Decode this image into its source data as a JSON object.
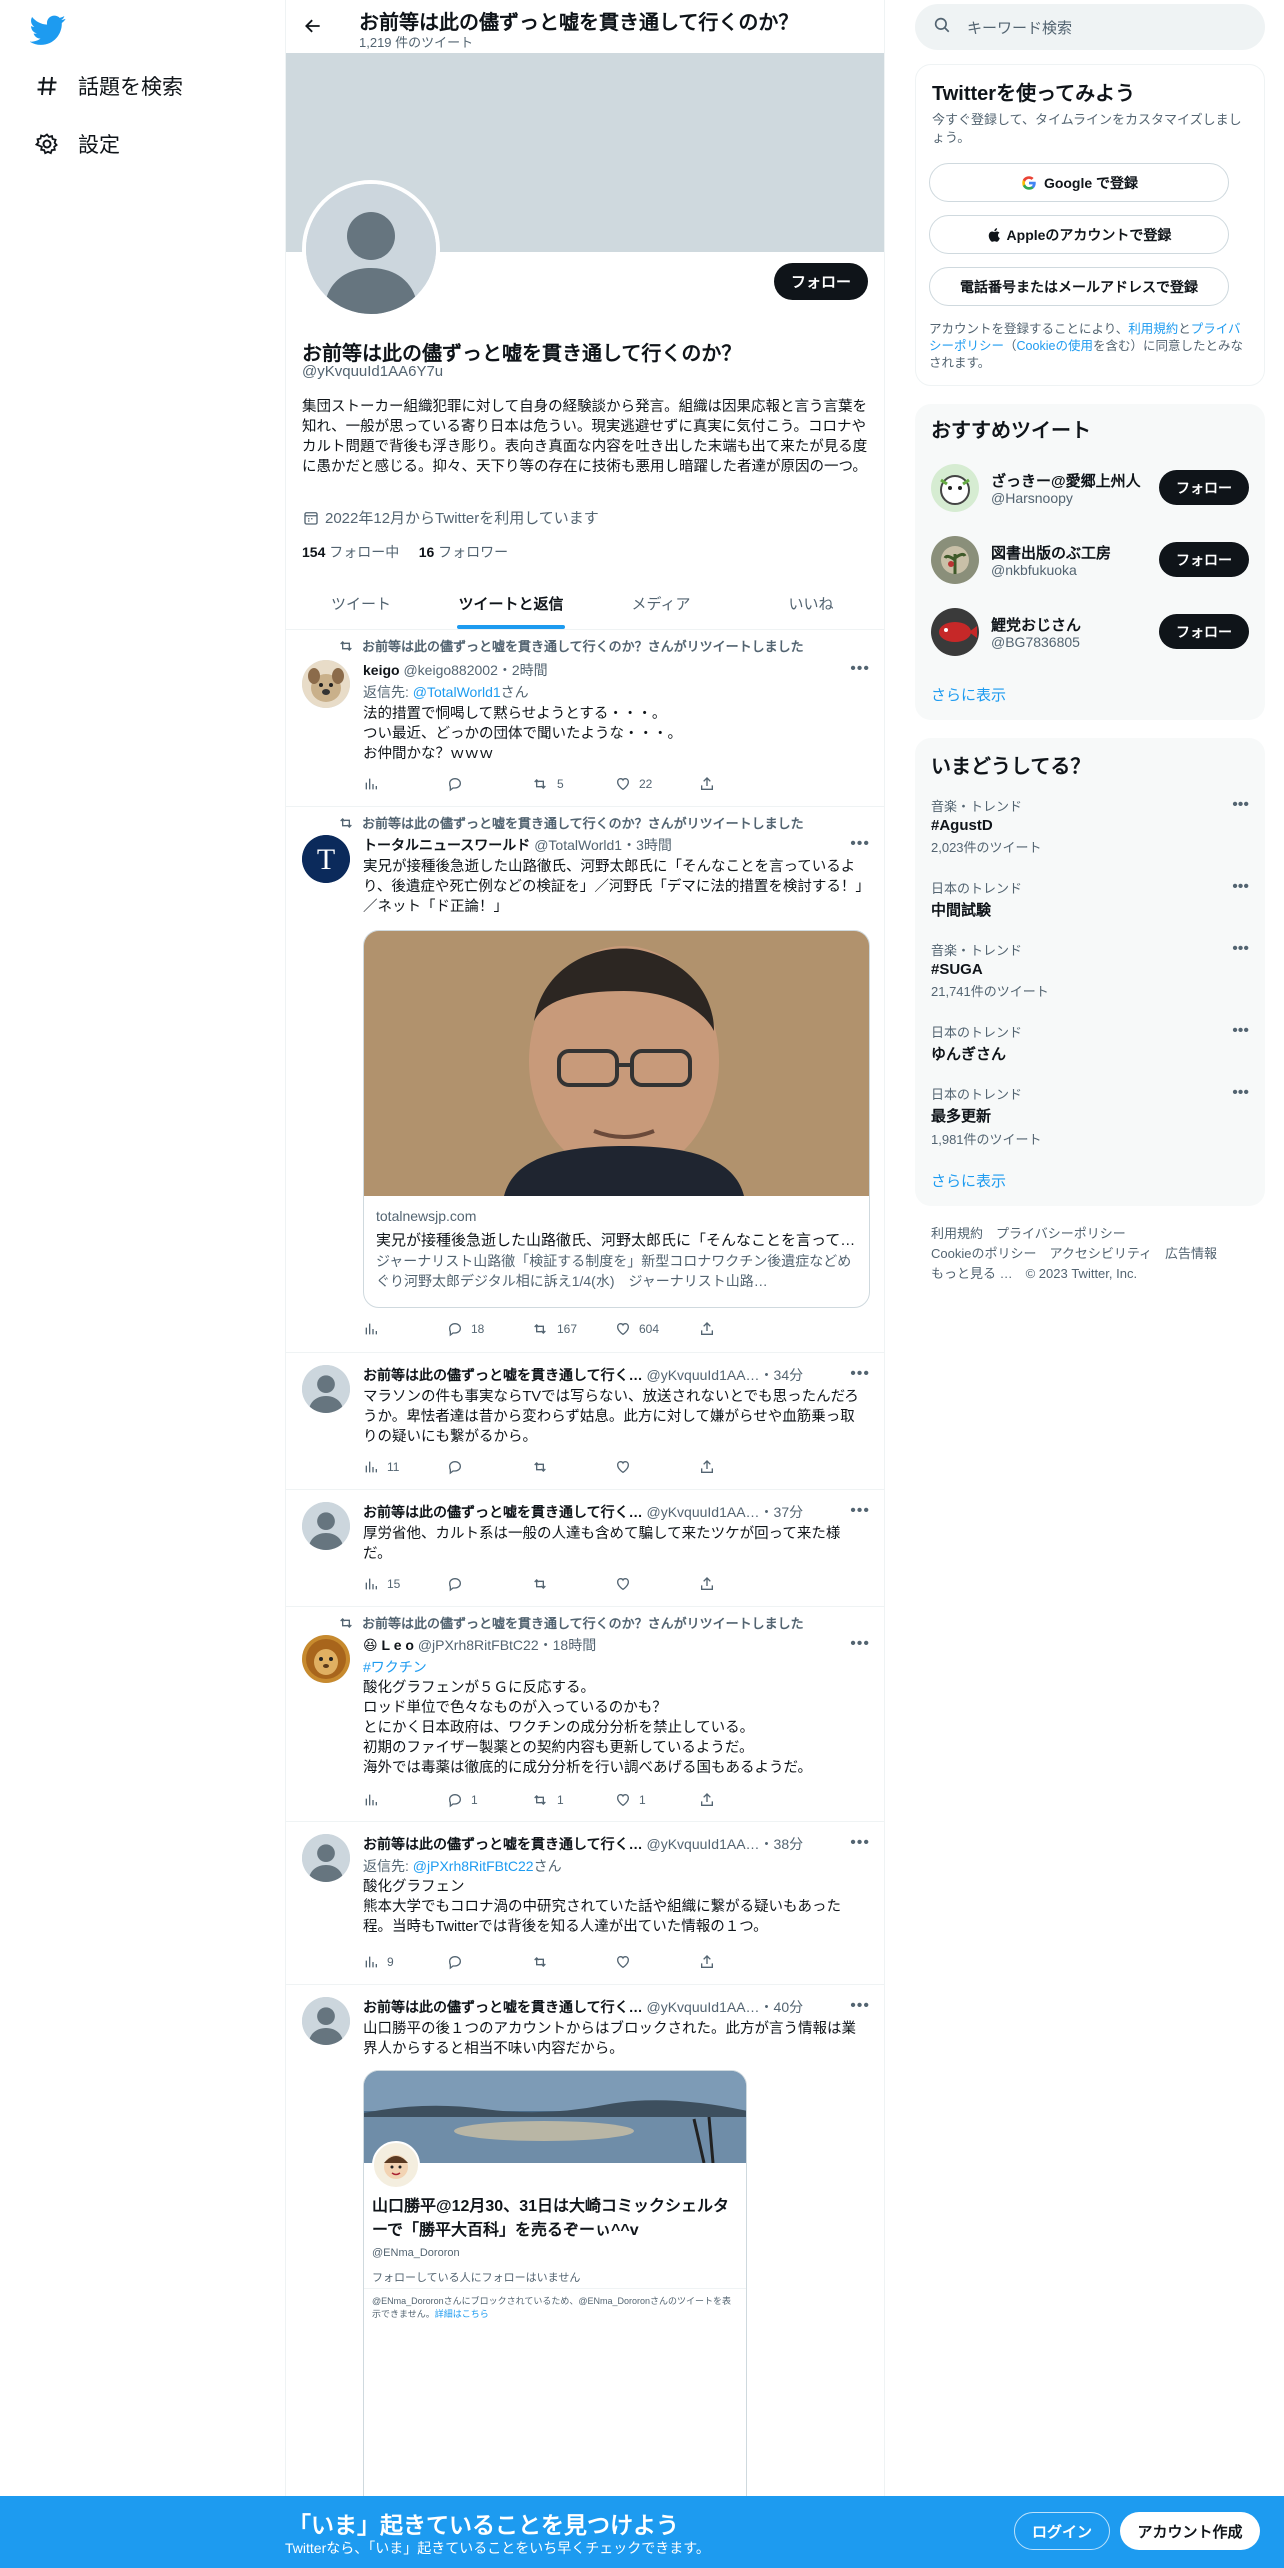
{
  "nav": {
    "explore_label": "話題を検索",
    "settings_label": "設定"
  },
  "header": {
    "title": "お前等は此の儘ずっと嘘を貫き通して行くのか？",
    "tweet_count": "1,219 件のツイート"
  },
  "profile": {
    "name": "お前等は此の儘ずっと嘘を貫き通して行くのか？",
    "handle": "@yKvquuId1AA6Y7u",
    "bio": "集団ストーカー組織犯罪に対して自身の経験談から発言。組織は因果応報と言う言葉を知れ、一般が思っている寄り日本は危うい。現実逃避せずに真実に気付こう。コロナやカルト問題で背後も浮き彫り。表向き真面な内容を吐き出した末端も出て来たが見る度に愚かだと感じる。抑々、天下り等の存在に技術も悪用し暗躍した者達が原因の一つ。",
    "joined": "2022年12月からTwitterを利用しています",
    "following_count": "154",
    "following_label": "フォロー中",
    "followers_count": "16",
    "followers_label": "フォロワー",
    "follow_button": "フォロー"
  },
  "tabs": [
    "ツイート",
    "ツイートと返信",
    "メディア",
    "いいね"
  ],
  "tweets": [
    {
      "retweet_note": "お前等は此の儘ずっと嘘を貫き通して行くのか？さんがリツイートしました",
      "name": "keigo",
      "handle": "@keigo882002",
      "time": "・2時間",
      "reply_prefix": "返信先: ",
      "reply_to": "@TotalWorld1",
      "reply_suffix": "さん",
      "text": "法的措置で恫喝して黙らせようとする・・・。\nつい最近、どっかの団体で聞いたような・・・。\nお仲間かな？ｗｗｗ",
      "views": "",
      "replies": "",
      "retweets": "5",
      "likes": "22"
    },
    {
      "retweet_note": "お前等は此の儘ずっと嘘を貫き通して行くのか？さんがリツイートしました",
      "name": "トータルニュースワールド",
      "handle": "@TotalWorld1",
      "time": "・3時間",
      "text": "実兄が接種後急逝した山路徹氏、河野太郎氏に「そんなことを言っているより、後遺症や死亡例などの検証を」／河野氏「デマに法的措置を検討する！」／ネット「ド正論！」",
      "card_domain": "totalnewsjp.com",
      "card_title": "実兄が接種後急逝した山路徹氏、河野太郎氏に「そんなことを言って…",
      "card_desc": "ジャーナリスト山路徹「検証する制度を」新型コロナワクチン後遺症などめぐり河野太郎デジタル相に訴え1/4(水)　ジャーナリスト山路…",
      "views": "",
      "replies": "18",
      "retweets": "167",
      "likes": "604"
    },
    {
      "name": "お前等は此の儘ずっと嘘を貫き通して行く…",
      "handle": "@yKvquuId1AA…",
      "time": "・34分",
      "text": "マラソンの件も事実ならTVでは写らない、放送されないとでも思ったんだろうか。卑怯者達は昔から変わらず姑息。此方に対して嫌がらせや血筋乗っ取りの疑いにも繋がるから。",
      "views": "11",
      "replies": "",
      "retweets": "",
      "likes": ""
    },
    {
      "name": "お前等は此の儘ずっと嘘を貫き通して行く…",
      "handle": "@yKvquuId1AA…",
      "time": "・37分",
      "text": "厚労省他、カルト系は一般の人達も含めて騙して来たツケが回って来た様だ。",
      "views": "15",
      "replies": "",
      "retweets": "",
      "likes": ""
    },
    {
      "retweet_note": "お前等は此の儘ずっと嘘を貫き通して行くのか？さんがリツイートしました",
      "name": "L e o",
      "handle": "@jPXrh8RitFBtC22",
      "time": "・18時間",
      "hashtag": "#ワクチン",
      "text": "酸化グラフェンが５Ｇに反応する。\nロッド単位で色々なものが入っているのかも？\nとにかく日本政府は、ワクチンの成分分析を禁止している。\n初期のファイザー製薬との契約内容も更新しているようだ。\n海外では毒薬は徹底的に成分分析を行い調べあげる国もあるようだ。",
      "views": "",
      "replies": "1",
      "retweets": "1",
      "likes": "1"
    },
    {
      "name": "お前等は此の儘ずっと嘘を貫き通して行く…",
      "handle": "@yKvquuId1AA…",
      "time": "・38分",
      "reply_prefix": "返信先: ",
      "reply_to": "@jPXrh8RitFBtC22",
      "reply_suffix": "さん",
      "text": "酸化グラフェン\n熊本大学でもコロナ渦の中研究されていた話や組織に繋がる疑いもあった程。当時もTwitterでは背後を知る人達が出ていた情報の１つ。",
      "views": "9",
      "replies": "",
      "retweets": "",
      "likes": ""
    },
    {
      "name": "お前等は此の儘ずっと嘘を貫き通して行く…",
      "handle": "@yKvquuId1AA…",
      "time": "・40分",
      "text": "山口勝平の後１つのアカウントからはブロックされた。此方が言う情報は業界人からすると相当不味い内容だから。",
      "embed_name": "山口勝平@12月30、31日は大崎コミックシェルターで「勝平大百科」を売るぞーぃ^^v",
      "embed_handle": "@ENma_Dororon",
      "embed_note": "フォローしている人にフォローはいません",
      "embed_blocked": "@ENma_Dororonさんにブロックされているため、@ENma_Dororonさんのツイートを表示できません。",
      "embed_link": "詳細はこちら"
    }
  ],
  "right": {
    "search_placeholder": "キーワード検索",
    "signup_title": "Twitterを使ってみよう",
    "signup_sub": "今すぐ登録して、タイムラインをカスタマイズしましょう。",
    "google_btn": "Google で登録",
    "apple_btn": "Appleのアカウントで登録",
    "phone_btn": "電話番号またはメールアドレスで登録",
    "terms_pre": "アカウントを登録することにより、",
    "terms_link": "利用規約",
    "terms_mid": "と",
    "privacy_link": "プライバシーポリシー",
    "cookie_pre": "（",
    "cookie_link": "Cookieの使用",
    "terms_post": "を含む）に同意したとみなされます。",
    "rec_title": "おすすめツイート",
    "recs": [
      {
        "name": "ざっきー@愛郷上州人",
        "handle": "@Harsnoopy",
        "button": "フォロー"
      },
      {
        "name": "図書出版のぶ工房",
        "handle": "@nkbfukuoka",
        "button": "フォロー"
      },
      {
        "name": "鯉党おじさん",
        "handle": "@BG7836805",
        "button": "フォロー"
      }
    ],
    "show_more": "さらに表示",
    "trends_title": "いまどうしてる？",
    "trends": [
      {
        "context": "音楽・トレンド",
        "name": "#AgustD",
        "count": "2,023件のツイート"
      },
      {
        "context": "日本のトレンド",
        "name": "中間試験",
        "count": ""
      },
      {
        "context": "音楽・トレンド",
        "name": "#SUGA",
        "count": "21,741件のツイート"
      },
      {
        "context": "日本のトレンド",
        "name": "ゆんぎさん",
        "count": ""
      },
      {
        "context": "日本のトレンド",
        "name": "最多更新",
        "count": "1,981件のツイート"
      }
    ],
    "footer_line1": "利用規約　プライバシーポリシー",
    "footer_line2": "Cookieのポリシー　アクセシビリティ　広告情報",
    "footer_line3": "もっと見る …　© 2023 Twitter, Inc."
  },
  "bottom": {
    "title": "「いま」起きていることを見つけよう",
    "subtitle": "Twitterなら、「いま」起きていることをいち早くチェックできます。",
    "login": "ログイン",
    "signup": "アカウント作成"
  },
  "colors": {
    "accent": "#1d9bf0",
    "text": "#0f1419",
    "muted": "#536471"
  }
}
